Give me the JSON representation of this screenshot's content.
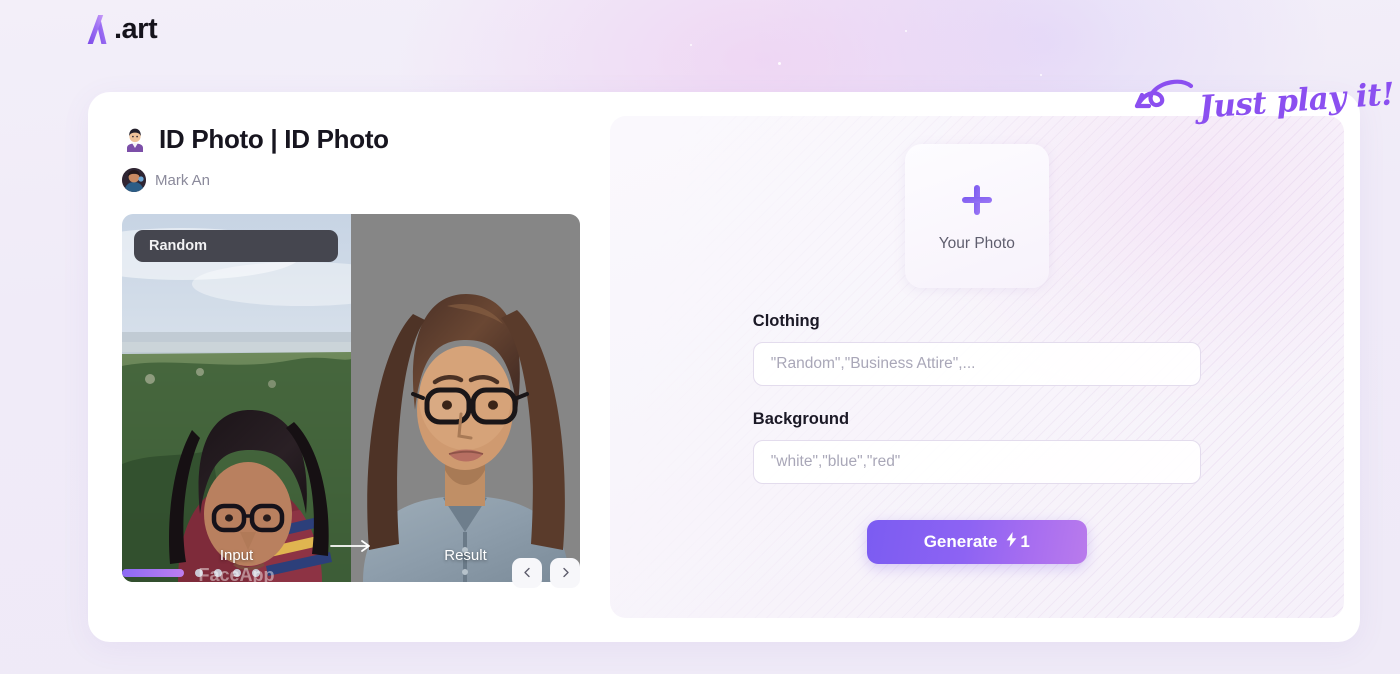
{
  "brand": {
    "name": ".art",
    "logo_icon": "a-letter-logo-icon",
    "accent": "#8b5cf6"
  },
  "annotation": {
    "text": "Just play it!",
    "arrow_icon": "curly-arrow-left-icon",
    "color": "#8b4ff0"
  },
  "workflow": {
    "emoji_icon": "businesswoman-emoji-icon",
    "title": "ID Photo | ID Photo",
    "author": {
      "name": "Mark An",
      "avatar_icon": "user-avatar"
    }
  },
  "preview": {
    "badge": "Random",
    "input_caption": "Input",
    "result_caption": "Result",
    "watermark": "FaceApp",
    "arrow_icon": "arrow-right-icon"
  },
  "carousel": {
    "total_slides": 5,
    "active_slide": 1,
    "prev_icon": "chevron-left-icon",
    "next_icon": "chevron-right-icon",
    "active_color": "#8c6af5",
    "inactive_color": "#c9c8d4"
  },
  "uploader": {
    "plus_icon": "plus-icon",
    "label": "Your Photo"
  },
  "form": {
    "fields": [
      {
        "label": "Clothing",
        "value": "",
        "placeholder": "\"Random\",\"Business Attire\",..."
      },
      {
        "label": "Background",
        "value": "",
        "placeholder": "\"white\",\"blue\",\"red\""
      }
    ]
  },
  "generate": {
    "label": "Generate",
    "cost": "1",
    "cost_icon": "lightning-bolt-icon",
    "gradient_start": "#7b5cf2",
    "gradient_end": "#b97bec"
  }
}
